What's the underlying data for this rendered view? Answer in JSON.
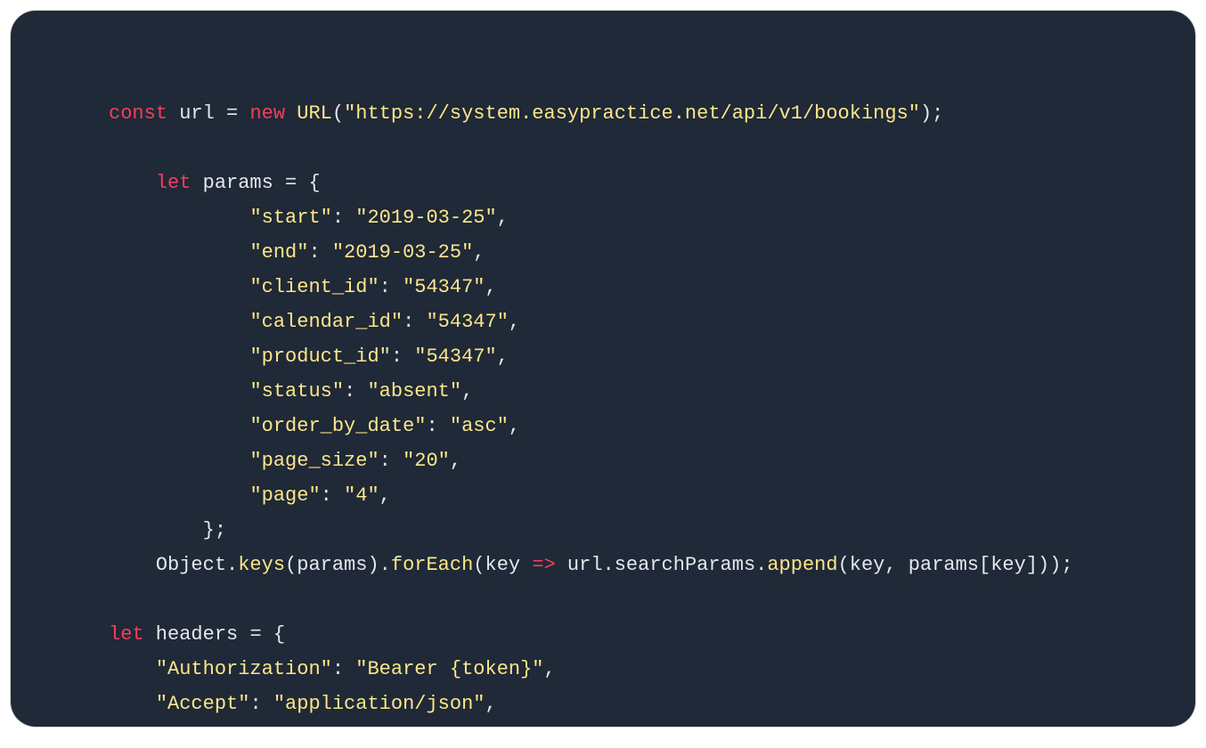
{
  "code": {
    "l1_const": "const",
    "l1_url": " url ",
    "l1_eq": "= ",
    "l1_new": "new",
    "l1_sp": " ",
    "l1_URL": "URL",
    "l1_open": "(",
    "l1_str": "\"https://system.easypractice.net/api/v1/bookings\"",
    "l1_close": ");",
    "l3_indent": "    ",
    "l3_let": "let",
    "l3_params": " params ",
    "l3_eq": "= {",
    "l4_indent": "            ",
    "l4_key": "\"start\"",
    "l4_colon": ": ",
    "l4_val": "\"2019-03-25\"",
    "l4_comma": ",",
    "l5_key": "\"end\"",
    "l5_val": "\"2019-03-25\"",
    "l6_key": "\"client_id\"",
    "l6_val": "\"54347\"",
    "l7_key": "\"calendar_id\"",
    "l7_val": "\"54347\"",
    "l8_key": "\"product_id\"",
    "l8_val": "\"54347\"",
    "l9_key": "\"status\"",
    "l9_val": "\"absent\"",
    "l10_key": "\"order_by_date\"",
    "l10_val": "\"asc\"",
    "l11_key": "\"page_size\"",
    "l11_val": "\"20\"",
    "l12_key": "\"page\"",
    "l12_val": "\"4\"",
    "l13_indent": "        ",
    "l13_close": "};",
    "l14_indent": "    ",
    "l14_obj": "Object",
    "l14_dot1": ".",
    "l14_keys": "keys",
    "l14_open1": "(params).",
    "l14_foreach": "forEach",
    "l14_open2": "(key ",
    "l14_arrow": "=>",
    "l14_rest": " url.searchParams.",
    "l14_append": "append",
    "l14_tail": "(key, params[key]));",
    "l16_let": "let",
    "l16_headers": " headers ",
    "l16_eq": "= {",
    "l17_indent": "    ",
    "l17_key": "\"Authorization\"",
    "l17_val": "\"Bearer {token}\"",
    "l18_key": "\"Accept\"",
    "l18_val": "\"application/json\""
  }
}
